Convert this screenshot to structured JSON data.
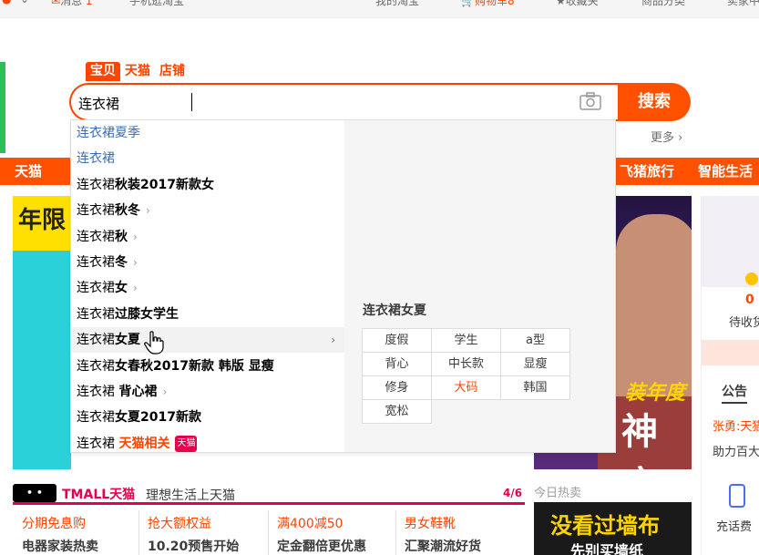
{
  "topbar": {
    "messages_label": "消息",
    "messages_count": "1",
    "mobile": "手机逛淘宝",
    "find": "我的淘宝",
    "cart_label": "购物车",
    "cart_count": "8",
    "fav": "收藏夹",
    "category": "商品分类",
    "seller": "卖家中"
  },
  "search": {
    "tabs": [
      "宝贝",
      "天猫",
      "店铺"
    ],
    "value": "连衣裙",
    "button": "搜索",
    "more": "更多 ›"
  },
  "nav": {
    "left": "天猫",
    "right1": "飞猪旅行",
    "right2": "智能生活"
  },
  "dropdown": {
    "items": [
      {
        "text": "连衣裙夏季",
        "bold": "",
        "history": true
      },
      {
        "text": "连衣裙",
        "bold": "",
        "history": true
      },
      {
        "text": "连衣裙",
        "bold": "秋装2017新款女"
      },
      {
        "text": "连衣裙",
        "bold": "秋冬",
        "chev": "›"
      },
      {
        "text": "连衣裙",
        "bold": "秋",
        "chev": "›"
      },
      {
        "text": "连衣裙",
        "bold": "冬",
        "chev": "›"
      },
      {
        "text": "连衣裙",
        "bold": "女",
        "chev": "›"
      },
      {
        "text": "连衣裙",
        "bold": "过膝女学生"
      },
      {
        "text": "连衣裙",
        "bold": "女夏",
        "rchev": "›"
      },
      {
        "text": "连衣裙",
        "bold": "女春秋2017新款 韩版 显瘦"
      },
      {
        "text": "连衣裙 ",
        "bold": "背心裙",
        "chev": "›"
      },
      {
        "text": "连衣裙",
        "bold": "女夏2017新款"
      },
      {
        "text": "连衣裙 ",
        "red": "天猫相关",
        "badge": "天猫"
      }
    ],
    "panel_title": "连衣裙女夏",
    "attributes": [
      "度假",
      "学生",
      "a型",
      "背心",
      "中长款",
      "显瘦",
      "修身",
      "大码",
      "韩国",
      "宽松"
    ],
    "highlight_attr": "大码"
  },
  "banners": {
    "left_text": "年限",
    "center_line1": "装年度",
    "center_line2": "神店"
  },
  "right": {
    "count": "0",
    "pay": "待收货",
    "notice": "公告",
    "news1": "张勇:天猫",
    "news2": "助力百大",
    "recharge": "充话费"
  },
  "tmall": {
    "logo": "TMALL",
    "tm": "TMALL天猫",
    "slogan": "理想生活上天猫",
    "page": "4/6",
    "promos": [
      {
        "a": "分期免息购",
        "b": "电器家装热卖"
      },
      {
        "a": "抢大额权益",
        "b": "10.20预售开始"
      },
      {
        "a": "满400减50",
        "b": "定金翻倍更优惠"
      },
      {
        "a": "男女鞋靴",
        "b": "汇聚潮流好货"
      }
    ]
  },
  "hot": {
    "label": "今日热卖",
    "line1": "没看过墙布",
    "line2": "先别买墙纸"
  },
  "colors": {
    "brand": "#ff5000",
    "tmall": "#e5004f"
  }
}
